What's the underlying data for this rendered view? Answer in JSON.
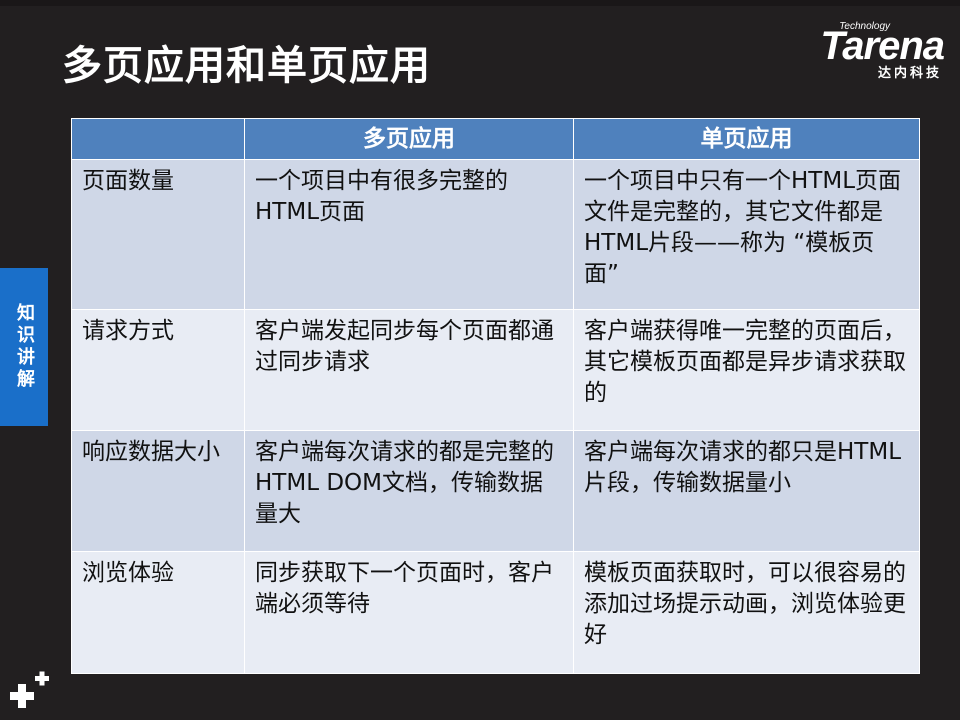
{
  "title": "多页应用和单页应用",
  "logo": {
    "tech": "Technology",
    "word": "Tarena",
    "cn": "达内科技"
  },
  "side_tab": {
    "label": "知识讲解",
    "color": "#1a6fc9"
  },
  "table": {
    "header_color": "#4f81bd",
    "headers": [
      "",
      "多页应用",
      "单页应用"
    ],
    "rows": [
      {
        "label": "页面数量",
        "multi": "一个项目中有很多完整的HTML页面",
        "single": "一个项目中只有一个HTML页面文件是完整的，其它文件都是HTML片段——称为 “模板页面”"
      },
      {
        "label": "请求方式",
        "multi": "客户端发起同步每个页面都通过同步请求",
        "single": "客户端获得唯一完整的页面后，其它模板页面都是异步请求获取的"
      },
      {
        "label": "响应数据大小",
        "multi": "客户端每次请求的都是完整的HTML DOM文档，传输数据量大",
        "single": "客户端每次请求的都只是HTML片段，传输数据量小"
      },
      {
        "label": "浏览体验",
        "multi": "同步获取下一个页面时，客户端必须等待",
        "single": "模板页面获取时，可以很容易的添加过场提示动画，浏览体验更好"
      }
    ]
  },
  "icons": {
    "corner": "plus-plus-icon"
  }
}
